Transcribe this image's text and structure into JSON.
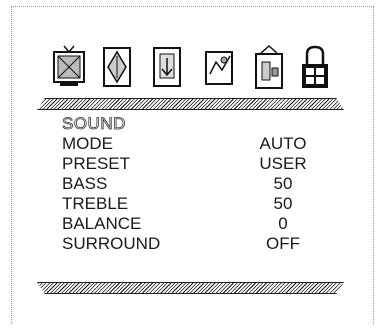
{
  "menu_title": "SOUND",
  "icons": [
    {
      "name": "tv-icon"
    },
    {
      "name": "picture-icon"
    },
    {
      "name": "sound-icon"
    },
    {
      "name": "feature-icon"
    },
    {
      "name": "setup-icon"
    },
    {
      "name": "lock-icon"
    }
  ],
  "items": [
    {
      "label": "MODE",
      "value": "AUTO"
    },
    {
      "label": "PRESET",
      "value": "USER"
    },
    {
      "label": "BASS",
      "value": "50"
    },
    {
      "label": "TREBLE",
      "value": "50"
    },
    {
      "label": "BALANCE",
      "value": "0"
    },
    {
      "label": "SURROUND",
      "value": "OFF"
    }
  ]
}
